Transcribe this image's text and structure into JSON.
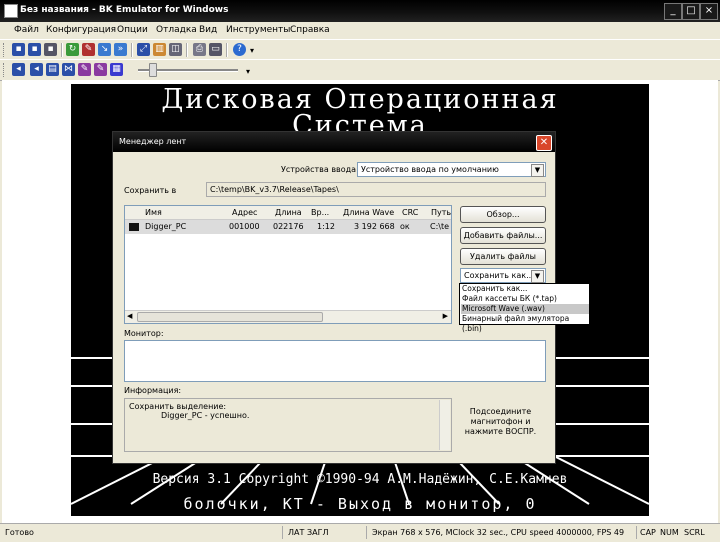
{
  "window": {
    "title": "Без названия - BK Emulator for Windows",
    "controls": [
      "_",
      "□",
      "×"
    ]
  },
  "menu": [
    "Файл",
    "Конфигурация",
    "Опции",
    "Отладка",
    "Вид",
    "Инструменты",
    "Справка"
  ],
  "screen": {
    "line1": "Дисковая Операционная",
    "line2": "Система",
    "line3": "Версия 3.1 Copyright ©1990-94 А.М.Надёжин, С.Е.Камнев",
    "line4": "болочки, КТ - Выход в монитор, 0"
  },
  "dialog": {
    "title": "Менеджер лент",
    "input_device_label": "Устройства ввода:",
    "input_device_value": "Устройство ввода по умолчанию",
    "save_to_label": "Сохранить в",
    "save_to_value": "C:\\temp\\BK_v3.7\\Release\\Tapes\\",
    "columns": [
      "Имя",
      "Адрес",
      "Длина",
      "Вр...",
      "Длина Wave",
      "CRC",
      "Путь"
    ],
    "row": {
      "name": "Digger_PC",
      "address": "001000",
      "length": "022176",
      "time": "1:12",
      "wave_length": "3 192 668",
      "crc": "ок",
      "path": "C:\\te"
    },
    "buttons": {
      "browse": "Обзор...",
      "add_files": "Добавить файлы...",
      "delete_files": "Удалить файлы",
      "save_as": "Сохранить как..."
    },
    "save_options": [
      "Сохранить как...",
      "Файл кассеты БК (*.tap)",
      "Microsoft Wave (.wav)",
      "Бинарный файл эмулятора (.bin)"
    ],
    "monitor_label": "Монитор:",
    "info_label": "Информация:",
    "info_line1": "Сохранить выделение:",
    "info_line2": "Digger_PC - успешно.",
    "hint_line1": "Подсоедините",
    "hint_line2": "магнитофон и",
    "hint_line3": "нажмите ВОСПР."
  },
  "status": {
    "ready": "Готово",
    "lat": "ЛАТ",
    "zagl": "ЗАГЛ",
    "info": "Экран 768 x 576, MClock 32 sec., CPU speed 4000000, FPS 49",
    "cap": "CAP",
    "num": "NUM",
    "scrl": "SCRL"
  }
}
